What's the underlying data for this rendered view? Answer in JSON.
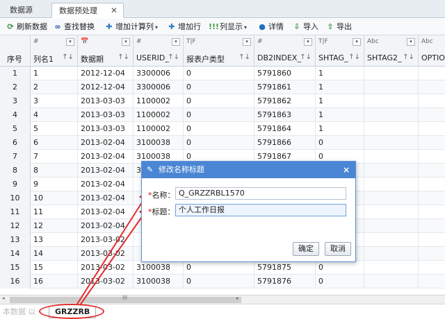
{
  "tabs": [
    {
      "label": "数据源"
    },
    {
      "label": "数据预处理",
      "close": "✕"
    }
  ],
  "toolbar": [
    {
      "icon": "refresh-icon",
      "glyph": "⟳",
      "color": "#2f8a3a",
      "label": "刷新数据"
    },
    {
      "icon": "binoculars-icon",
      "glyph": "∞",
      "color": "#1f4f9a",
      "label": "查找替换"
    },
    {
      "icon": "plus-icon",
      "glyph": "✚",
      "color": "#2e7dc7",
      "label": "增加计算列",
      "caret": "▾"
    },
    {
      "icon": "plus-icon",
      "glyph": "✚",
      "color": "#2e7dc7",
      "label": "增加行"
    },
    {
      "icon": "columns-icon",
      "glyph": "!!!",
      "color": "#3a9a3a",
      "label": "列显示",
      "caret": "▾"
    },
    {
      "icon": "info-icon",
      "glyph": "●",
      "color": "#1f6fbf",
      "label": "详情"
    },
    {
      "icon": "import-icon",
      "glyph": "⇩",
      "color": "#3a8a3a",
      "label": "导入"
    },
    {
      "icon": "export-icon",
      "glyph": "⇧",
      "color": "#3a8a3a",
      "label": "导出"
    }
  ],
  "columns": [
    {
      "name": "序号",
      "type": ""
    },
    {
      "name": "列名1",
      "type": "#"
    },
    {
      "name": "数据期",
      "type": "📅"
    },
    {
      "name": "USERID_",
      "type": "#"
    },
    {
      "name": "报表户类型",
      "type": "T|F"
    },
    {
      "name": "DB2INDEX_",
      "type": "#"
    },
    {
      "name": "SHTAG_",
      "type": "T|F"
    },
    {
      "name": "SHTAG2_",
      "type": "Abc"
    },
    {
      "name": "OPTIO",
      "type": "Abc"
    }
  ],
  "rows": [
    [
      "1",
      "1",
      "2012-12-04",
      "3300006",
      "0",
      "5791860",
      "1",
      ""
    ],
    [
      "2",
      "2",
      "2012-12-04",
      "3300006",
      "0",
      "5791861",
      "1",
      ""
    ],
    [
      "3",
      "3",
      "2013-03-03",
      "1100002",
      "0",
      "5791862",
      "1",
      ""
    ],
    [
      "4",
      "4",
      "2013-03-03",
      "1100002",
      "0",
      "5791863",
      "1",
      ""
    ],
    [
      "5",
      "5",
      "2013-03-03",
      "1100002",
      "0",
      "5791864",
      "1",
      ""
    ],
    [
      "6",
      "6",
      "2013-02-04",
      "3100038",
      "0",
      "5791866",
      "0",
      ""
    ],
    [
      "7",
      "7",
      "2013-02-04",
      "3100038",
      "0",
      "5791867",
      "0",
      ""
    ],
    [
      "8",
      "8",
      "2013-02-04",
      "3100038",
      "",
      "",
      "",
      ""
    ],
    [
      "9",
      "9",
      "2013-02-04",
      "",
      "",
      "",
      "",
      ""
    ],
    [
      "10",
      "10",
      "2013-02-04",
      "",
      "",
      "",
      "",
      ""
    ],
    [
      "11",
      "11",
      "2013-02-04",
      "",
      "",
      "",
      "",
      ""
    ],
    [
      "12",
      "12",
      "2013-02-04",
      "",
      "",
      "",
      "",
      ""
    ],
    [
      "13",
      "13",
      "2013-03-02",
      "",
      "",
      "",
      "",
      ""
    ],
    [
      "14",
      "14",
      "2013-03-02",
      "",
      "",
      "",
      "",
      ""
    ],
    [
      "15",
      "15",
      "2013-03-02",
      "3100038",
      "0",
      "5791875",
      "0",
      ""
    ],
    [
      "16",
      "16",
      "2013-03-02",
      "3100038",
      "0",
      "5791876",
      "0",
      ""
    ]
  ],
  "scrollbar": {
    "grip": "III",
    "left": "◂",
    "right": "▸"
  },
  "bottom_tab": {
    "label": "GRZZRB",
    "watermark": "本数据 以"
  },
  "dialog": {
    "title": "修改名称标题",
    "close": "×",
    "name_label": "名称：",
    "name_value": "Q_GRZZRBL1570",
    "title_label": "标题：",
    "title_value": "个人工作日报",
    "required_mark": "*",
    "ok": "确定",
    "cancel": "取消"
  },
  "colors": {
    "accent": "#4a86d4",
    "annotation": "#e32b2b"
  }
}
